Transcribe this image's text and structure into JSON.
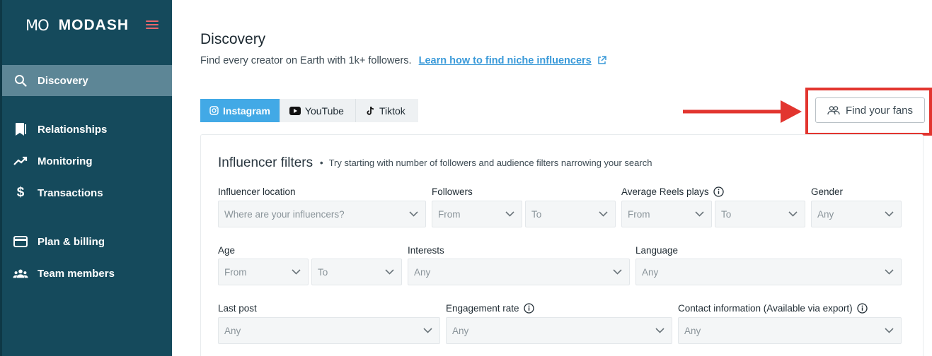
{
  "brand": {
    "mark": "MO",
    "name": "MODASH",
    "accent": "#e8666b"
  },
  "sidebar": {
    "bg": "#154a5c",
    "items": [
      {
        "label": "Discovery",
        "icon": "search-icon",
        "active": true
      },
      {
        "label": "Relationships",
        "icon": "bookmark-icon"
      },
      {
        "label": "Monitoring",
        "icon": "trend-icon"
      },
      {
        "label": "Transactions",
        "icon": "dollar-icon"
      },
      {
        "label": "Plan & billing",
        "icon": "card-icon"
      },
      {
        "label": "Team members",
        "icon": "team-icon"
      }
    ]
  },
  "header": {
    "title": "Discovery",
    "subtitle": "Find every creator on Earth with 1k+ followers.",
    "link": "Learn how to find niche influencers"
  },
  "platform_tabs": [
    {
      "label": "Instagram",
      "icon": "instagram-icon",
      "active": true
    },
    {
      "label": "YouTube",
      "icon": "youtube-icon"
    },
    {
      "label": "Tiktok",
      "icon": "tiktok-icon"
    }
  ],
  "find_fans": {
    "label": "Find your fans",
    "icon": "people-icon"
  },
  "filters": {
    "title": "Influencer filters",
    "hint": "Try starting with number of followers and audience filters narrowing your search",
    "location": {
      "label": "Influencer location",
      "placeholder": "Where are your influencers?"
    },
    "followers": {
      "label": "Followers",
      "from": "From",
      "to": "To"
    },
    "reels": {
      "label": "Average Reels plays",
      "from": "From",
      "to": "To"
    },
    "gender": {
      "label": "Gender",
      "value": "Any"
    },
    "age": {
      "label": "Age",
      "from": "From",
      "to": "To"
    },
    "interests": {
      "label": "Interests",
      "value": "Any"
    },
    "language": {
      "label": "Language",
      "value": "Any"
    },
    "last_post": {
      "label": "Last post",
      "value": "Any"
    },
    "engagement": {
      "label": "Engagement rate",
      "value": "Any"
    },
    "contact": {
      "label": "Contact information (Available via export)",
      "value": "Any"
    }
  }
}
